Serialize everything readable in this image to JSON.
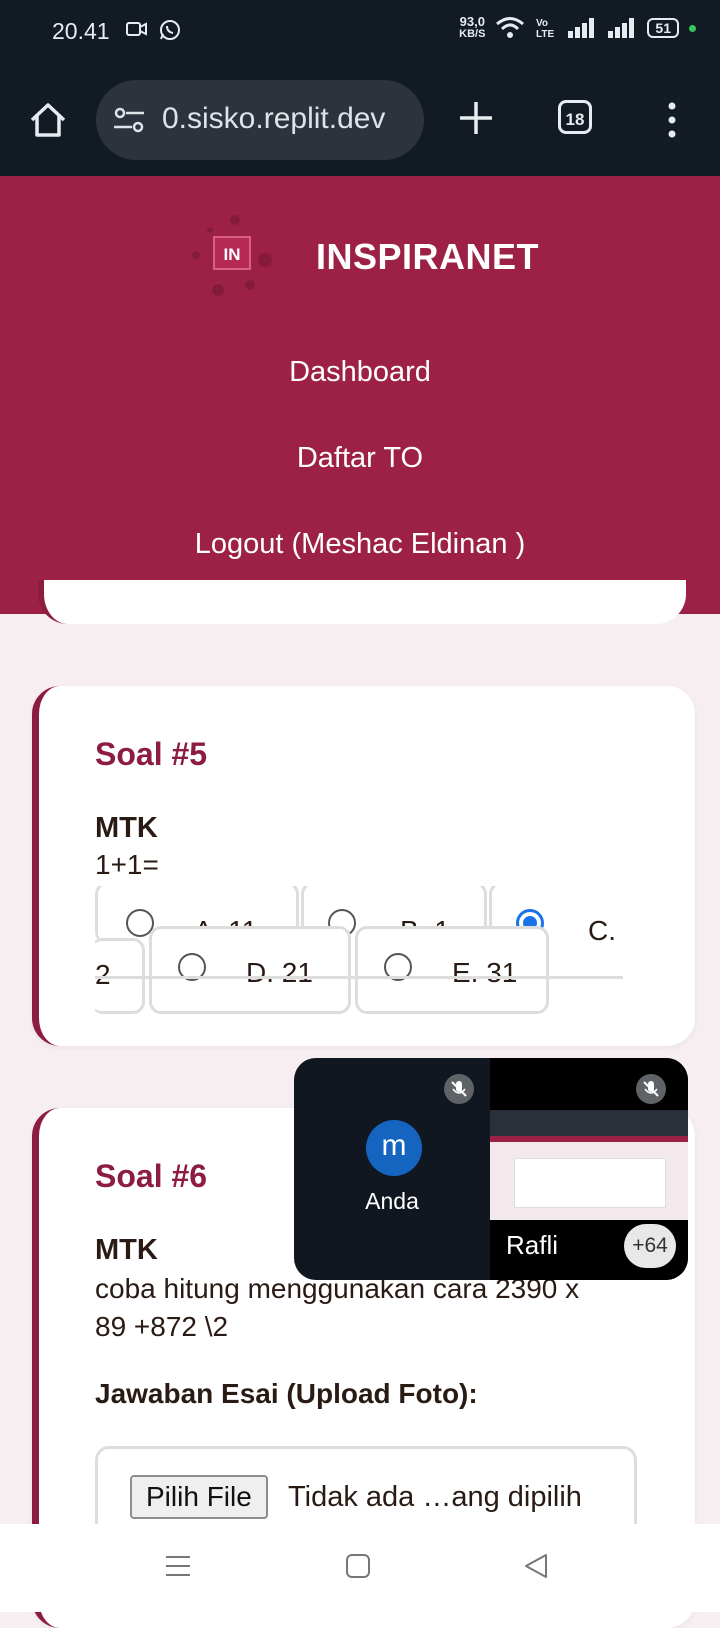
{
  "status_bar": {
    "time": "20.41",
    "speed_value": "93,0",
    "speed_unit": "KB/S",
    "battery": "51"
  },
  "browser": {
    "url": "0.sisko.replit.dev",
    "tab_count": "18"
  },
  "nav": {
    "logo_text": "IN",
    "brand": "INSPIRANET",
    "links": [
      "Dashboard",
      "Daftar TO",
      "Logout (Meshac Eldinan )"
    ]
  },
  "questions": [
    {
      "title": "Soal #5",
      "subject": "MTK",
      "text": "1+1=",
      "options": [
        {
          "label": "A. 11",
          "selected": false
        },
        {
          "label": "B. 1",
          "selected": false
        },
        {
          "label": "C.",
          "selected": true
        },
        {
          "label": "2",
          "selected": false
        },
        {
          "label": "D. 21",
          "selected": false
        },
        {
          "label": "E. 31",
          "selected": false
        }
      ]
    },
    {
      "title": "Soal #6",
      "subject": "MTK",
      "text_line1": "coba hitung menggunakan cara 2390 x",
      "text_line2": "89 +872 \\2",
      "essay_label": "Jawaban Esai (Upload Foto):",
      "file_button": "Pilih File",
      "file_status": "Tidak ada …ang dipilih"
    }
  ],
  "meet_overlay": {
    "self_initial": "m",
    "self_name": "Anda",
    "other_name": "Rafli",
    "participant_extra": "+64"
  },
  "colors": {
    "brand": "#9d2147",
    "accent_text": "#8c1d40",
    "radio_selected": "#1a73e8"
  }
}
